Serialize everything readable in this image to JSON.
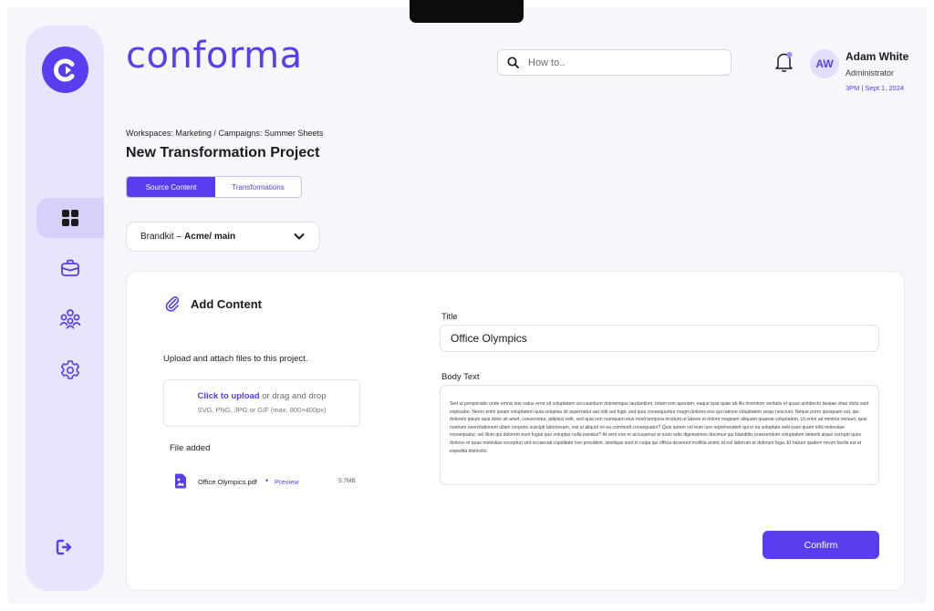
{
  "app": {
    "brand": "conforma"
  },
  "search": {
    "placeholder": "How to.."
  },
  "user": {
    "initials": "AW",
    "name": "Adam White",
    "role": "Administrator",
    "datetime": "3PM | Sept 1, 2024"
  },
  "sidebar": {
    "items": [
      {
        "icon": "dashboard-grid-icon",
        "active": true
      },
      {
        "icon": "briefcase-icon",
        "active": false
      },
      {
        "icon": "users-group-icon",
        "active": false
      },
      {
        "icon": "settings-gear-icon",
        "active": false
      }
    ],
    "logout_icon": "logout-icon"
  },
  "breadcrumb": "Workspaces: Marketing / Campaigns: Summer Sheets",
  "page_title": "New Transformation Project",
  "tabs": [
    {
      "label": "Source Content",
      "active": true
    },
    {
      "label": "Transformations",
      "active": false
    }
  ],
  "brandkit": {
    "label": "Brandkit –",
    "value": "Acme/ main"
  },
  "add_content": {
    "title": "Add Content",
    "description": "Upload and attach files to this project.",
    "dropzone": {
      "link": "Click to upload",
      "text": " or drag and drop",
      "hint": "SVG, PNG, JPG or GIF (max. 800×400px)"
    },
    "file_added_label": "File added",
    "file": {
      "name": "Office Olympics.pdf",
      "separator": "•",
      "preview": "Preview",
      "size": "5.7MB"
    }
  },
  "form": {
    "title_label": "Title",
    "title_value": "Office Olympics",
    "body_label": "Body Text",
    "body_value": "Sed ut perspiciatis unde omnis iste natus error sit voluptatem accusantium doloremque laudantium, totam rem aperiam, eaque ipsa quae ab illo inventore veritatis et quasi architecto beatae vitae dicta sunt explicabo. Nemo enim ipsam voluptatem quia voluptas sit aspernatur aut odit aut fugit, sed quia consequuntur magni dolores eos qui ratione voluptatem sequi nesciunt. Neque porro quisquam est, qui dolorem ipsum quia dolor sit amet, consectetur, adipisci velit, sed quia non numquam eius modi tempora incidunt ut labore et dolore magnam aliquam quaerat voluptatem. Ut enim ad minima veniam, quis nostrum exercitationem ullam corporis suscipit laboriosam, nisi ut aliquid ex ea commodi consequatur? Quis autem vel eum iure reprehenderit qui in ea voluptate velit esse quam nihil molestiae consequatur, vel illum qui dolorem eum fugiat quo voluptas nulla pariatur? At vero eos et accusamus et iusto odio dignissimos ducimus qui blanditiis praesentium voluptatum deleniti atque corrupti quos dolores et quas molestias excepturi sint occaecati cupiditate non provident, similique sunt in culpa qui officia deserunt mollitia animi, id est laborum et dolorum fuga. Et harum quidem rerum facilis est et expedita distinctio.",
    "confirm_label": "Confirm"
  },
  "colors": {
    "accent": "#5b3df0",
    "sidebar_bg": "#e8e4fb",
    "page_bg": "#f7f6fb"
  }
}
